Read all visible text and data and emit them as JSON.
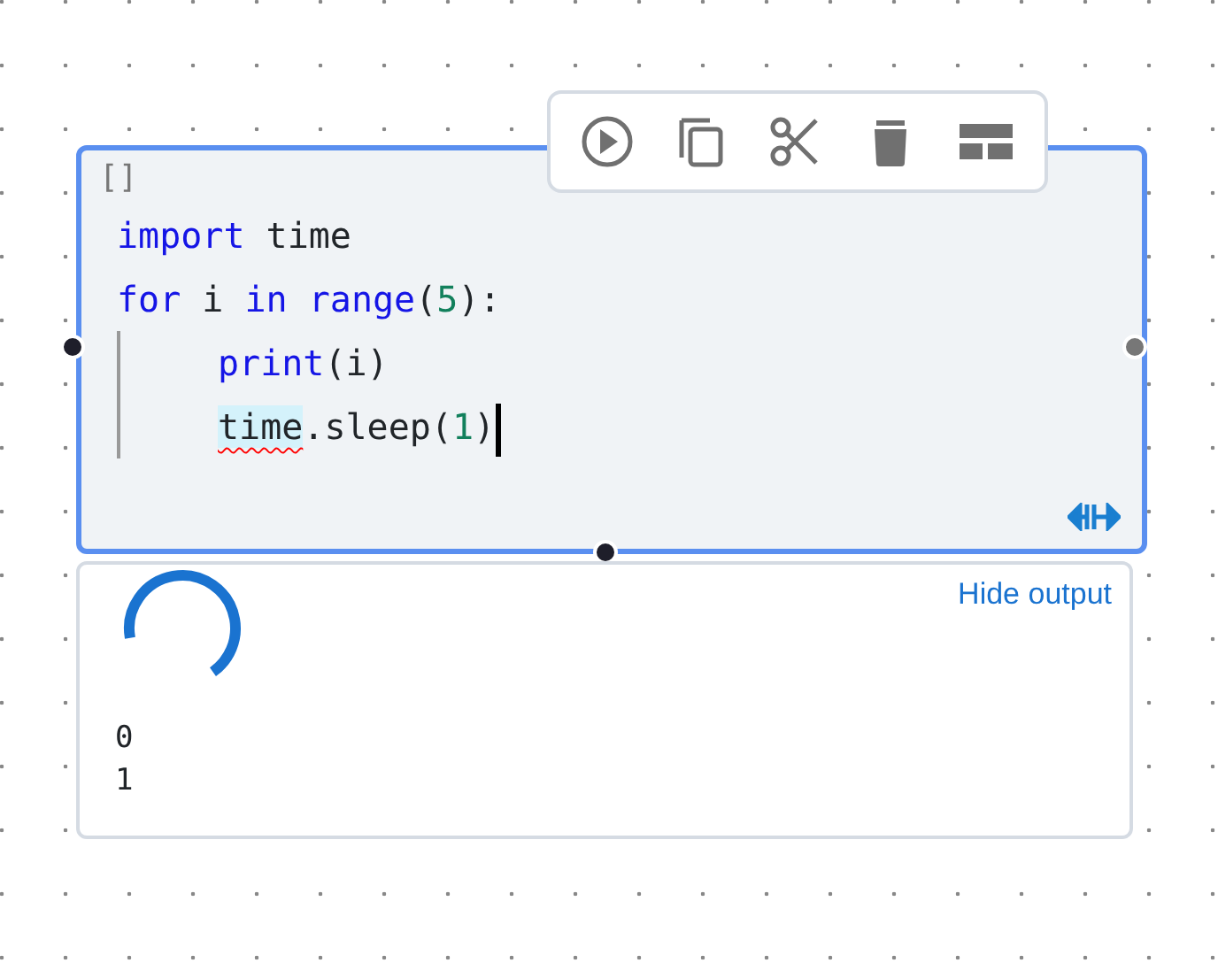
{
  "toolbar": [
    {
      "kind": "run"
    },
    {
      "kind": "copy"
    },
    {
      "kind": "cut"
    },
    {
      "kind": "delete"
    },
    {
      "kind": "split"
    }
  ],
  "cell": {
    "focused": true,
    "prompt": "[]",
    "lines": [
      {
        "tokens": [
          {
            "text": "import",
            "kind": "keyword"
          },
          {
            "text": " time",
            "kind": "plain"
          }
        ]
      },
      {
        "tokens": [
          {
            "text": "for",
            "kind": "keyword"
          },
          {
            "text": " i ",
            "kind": "plain"
          },
          {
            "text": "in",
            "kind": "keyword"
          },
          {
            "text": " range",
            "kind": "keyword"
          },
          {
            "text": "(",
            "kind": "plain"
          },
          {
            "text": "5",
            "kind": "number"
          },
          {
            "text": "):",
            "kind": "plain"
          }
        ],
        "children": [
          {
            "tokens": [
              {
                "text": "print",
                "kind": "keyword"
              },
              {
                "text": "(i)",
                "kind": "plain"
              }
            ]
          },
          {
            "tokens": [
              {
                "text": "time",
                "kind": "plain",
                "misspelled": true
              },
              {
                "text": ".sleep(",
                "kind": "plain"
              },
              {
                "text": "1",
                "kind": "number"
              },
              {
                "text": ")",
                "kind": "plain"
              }
            ]
          }
        ]
      }
    ]
  },
  "output": {
    "running": true,
    "toggle": "Hide output",
    "lines": [
      "0",
      "1"
    ]
  }
}
